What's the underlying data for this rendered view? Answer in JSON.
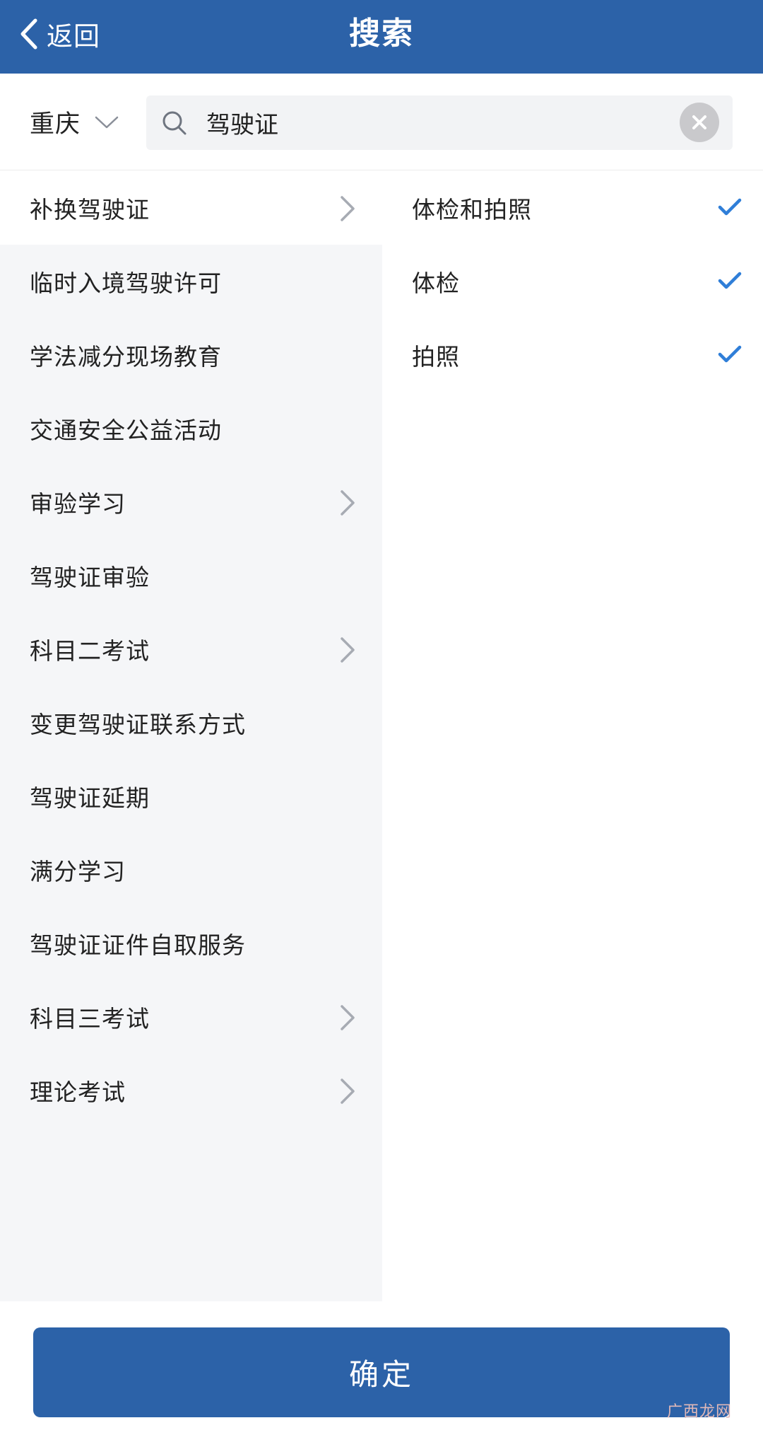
{
  "header": {
    "back_label": "返回",
    "title": "搜索",
    "background_color": "#2c62a8"
  },
  "search": {
    "city": "重庆",
    "query": "驾驶证",
    "icons": [
      "search-icon",
      "clear-icon",
      "chevron-down-icon"
    ]
  },
  "categories": [
    {
      "label": "补换驾驶证",
      "has_children": true,
      "active": true
    },
    {
      "label": "临时入境驾驶许可",
      "has_children": false
    },
    {
      "label": "学法减分现场教育",
      "has_children": false
    },
    {
      "label": "交通安全公益活动",
      "has_children": false
    },
    {
      "label": "审验学习",
      "has_children": true
    },
    {
      "label": "驾驶证审验",
      "has_children": false
    },
    {
      "label": "科目二考试",
      "has_children": true
    },
    {
      "label": "变更驾驶证联系方式",
      "has_children": false
    },
    {
      "label": "驾驶证延期",
      "has_children": false
    },
    {
      "label": "满分学习",
      "has_children": false
    },
    {
      "label": "驾驶证证件自取服务",
      "has_children": false
    },
    {
      "label": "科目三考试",
      "has_children": true
    },
    {
      "label": "理论考试",
      "has_children": true
    }
  ],
  "subitems": [
    {
      "label": "体检和拍照",
      "checked": true
    },
    {
      "label": "体检",
      "checked": true
    },
    {
      "label": "拍照",
      "checked": true
    }
  ],
  "confirm_label": "确定",
  "watermark": "广西龙网",
  "colors": {
    "accent": "#2c62a8",
    "check": "#2f7ed8",
    "left_pane_bg": "#f5f6f8"
  }
}
